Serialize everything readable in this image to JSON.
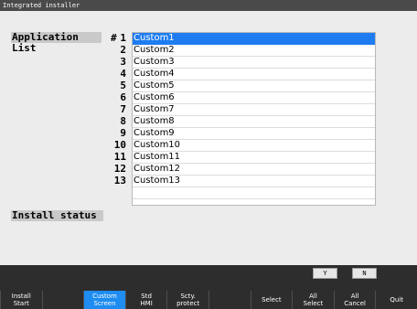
{
  "window": {
    "title": "Integrated installer"
  },
  "labels": {
    "application_list": "Application List",
    "list_hash": "#",
    "install_status": "Install status"
  },
  "apps": [
    {
      "num": "1",
      "name": "Custom1"
    },
    {
      "num": "2",
      "name": "Custom2"
    },
    {
      "num": "3",
      "name": "Custom3"
    },
    {
      "num": "4",
      "name": "Custom4"
    },
    {
      "num": "5",
      "name": "Custom5"
    },
    {
      "num": "6",
      "name": "Custom6"
    },
    {
      "num": "7",
      "name": "Custom7"
    },
    {
      "num": "8",
      "name": "Custom8"
    },
    {
      "num": "9",
      "name": "Custom9"
    },
    {
      "num": "10",
      "name": "Custom10"
    },
    {
      "num": "11",
      "name": "Custom11"
    },
    {
      "num": "12",
      "name": "Custom12"
    },
    {
      "num": "13",
      "name": "Custom13"
    }
  ],
  "selected_index": 0,
  "dialog": {
    "yes": "Y",
    "no": "N"
  },
  "function_keys": [
    {
      "label": "Install\nStart",
      "active": false
    },
    {
      "label": "",
      "active": false
    },
    {
      "label": "Custom\nScreen",
      "active": true
    },
    {
      "label": "Std\nHMI",
      "active": false
    },
    {
      "label": "Scty.\nprotect",
      "active": false
    },
    {
      "label": "",
      "active": false
    },
    {
      "label": "Select",
      "active": false
    },
    {
      "label": "All\nSelect",
      "active": false
    },
    {
      "label": "All\nCancel",
      "active": false
    },
    {
      "label": "Quit",
      "active": false
    }
  ],
  "colors": {
    "selection": "#1e7cf0",
    "active_key": "#1e8cf0",
    "background": "#ececec"
  }
}
